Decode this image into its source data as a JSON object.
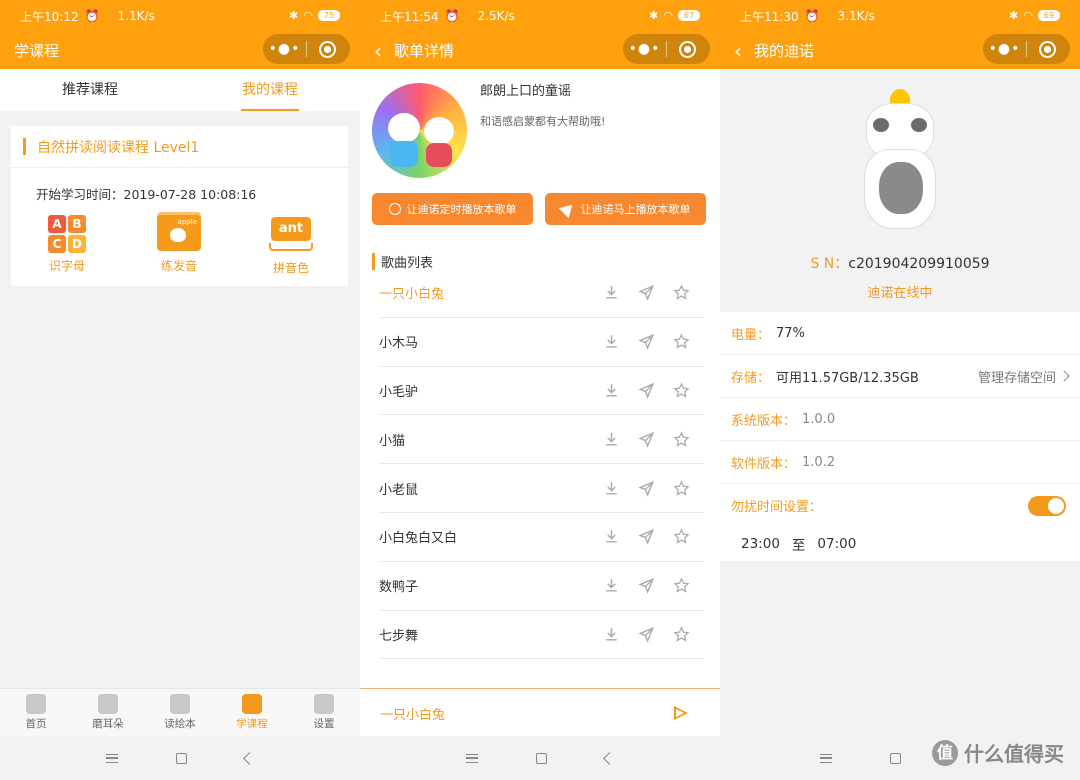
{
  "panels": [
    {
      "status": {
        "time": "上午10:12",
        "speed": "1.1K/s",
        "battery": "75"
      },
      "title": "学课程",
      "tabs": [
        "推荐课程",
        "我的课程"
      ],
      "course": {
        "title": "自然拼读阅读课程 Level1",
        "start_time": "开始学习时间：2019-07-28 10:08:16",
        "items": [
          {
            "label": "识字母",
            "icon": "abcd-icon"
          },
          {
            "label": "练发音",
            "icon": "apple-icon"
          },
          {
            "label": "拼音色",
            "icon": "ant-icon"
          }
        ],
        "abc_letters": [
          "A",
          "B",
          "C",
          "D"
        ],
        "apple_tag": "apple",
        "ant_text": "ant"
      },
      "bottom_tabs": [
        "首页",
        "磨耳朵",
        "读绘本",
        "学课程",
        "设置"
      ]
    },
    {
      "status": {
        "time": "上午11:54",
        "speed": "2.5K/s",
        "battery": "67"
      },
      "title": "歌单详情",
      "album": {
        "title": "郎朗上口的童谣",
        "desc": "和语感启蒙都有大帮助哦!"
      },
      "buttons": [
        "让迪诺定时播放本歌单",
        "让迪诺马上播放本歌单"
      ],
      "song_list_title": "歌曲列表",
      "songs": [
        "一只小白兔",
        "小木马",
        "小毛驴",
        "小猫",
        "小老鼠",
        "小白兔白又白",
        "数鸭子",
        "七步舞"
      ],
      "now_playing": "一只小白兔"
    },
    {
      "status": {
        "time": "上午11:30",
        "speed": "3.1K/s",
        "battery": "69"
      },
      "title": "我的迪诺",
      "sn_label": "S N：",
      "sn_value": "c201904209910059",
      "online_status": "迪诺在线中",
      "battery": {
        "label": "电量：",
        "value": "77%"
      },
      "storage": {
        "label": "存储：",
        "value": "可用11.57GB/12.35GB",
        "action": "管理存储空间"
      },
      "system_version": {
        "label": "系统版本：",
        "value": "1.0.0"
      },
      "software_version": {
        "label": "软件版本：",
        "value": "1.0.2"
      },
      "dnd": {
        "label": "勿扰时间设置：",
        "enabled": true,
        "from": "23:00",
        "to_word": "至",
        "to": "07:00"
      }
    }
  ],
  "watermark": {
    "logo": "值",
    "text": "什么值得买"
  },
  "colors": {
    "accent": "#ffa10f",
    "orange_text": "#f39a1e",
    "button": "#f7882f"
  }
}
